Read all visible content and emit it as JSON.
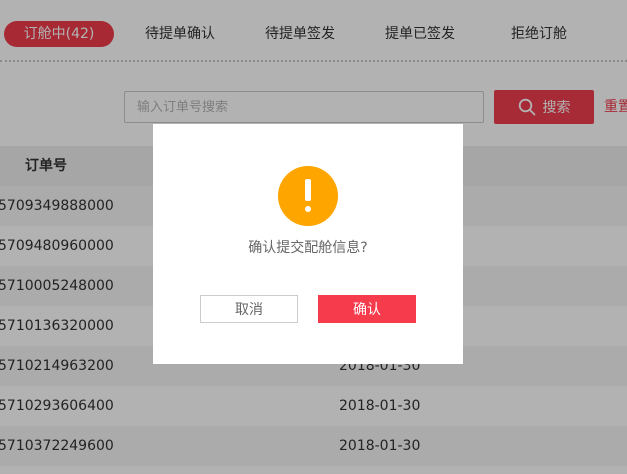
{
  "tabs": [
    {
      "label": "订舱中(42)"
    },
    {
      "label": "待提单确认"
    },
    {
      "label": "待提单签发"
    },
    {
      "label": "提单已签发"
    },
    {
      "label": "拒绝订舱"
    }
  ],
  "search": {
    "placeholder": "输入订单号搜索",
    "button_label": "搜索",
    "reset_label": "重置"
  },
  "table": {
    "header_order": "订单号",
    "rows": [
      {
        "order": "5709349888000",
        "date": ""
      },
      {
        "order": "5709480960000",
        "date": ""
      },
      {
        "order": "5710005248000",
        "date": ""
      },
      {
        "order": "5710136320000",
        "date": ""
      },
      {
        "order": "5710214963200",
        "date": "2018-01-30"
      },
      {
        "order": "5710293606400",
        "date": "2018-01-30"
      },
      {
        "order": "5710372249600",
        "date": "2018-01-30"
      }
    ]
  },
  "dialog": {
    "icon": "warning-icon",
    "message": "确认提交配舱信息?",
    "cancel_label": "取消",
    "confirm_label": "确认"
  },
  "colors": {
    "accent": "#ef3d4f",
    "warning": "#ffa500"
  }
}
